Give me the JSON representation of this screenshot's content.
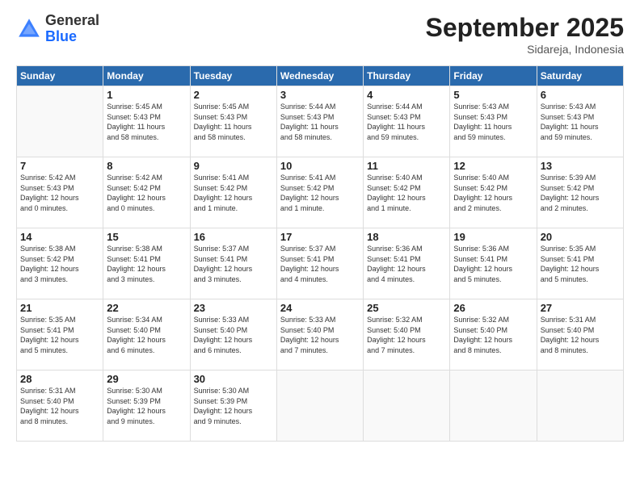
{
  "logo": {
    "general": "General",
    "blue": "Blue"
  },
  "title": "September 2025",
  "subtitle": "Sidareja, Indonesia",
  "header_days": [
    "Sunday",
    "Monday",
    "Tuesday",
    "Wednesday",
    "Thursday",
    "Friday",
    "Saturday"
  ],
  "weeks": [
    [
      {
        "day": "",
        "info": ""
      },
      {
        "day": "1",
        "info": "Sunrise: 5:45 AM\nSunset: 5:43 PM\nDaylight: 11 hours\nand 58 minutes."
      },
      {
        "day": "2",
        "info": "Sunrise: 5:45 AM\nSunset: 5:43 PM\nDaylight: 11 hours\nand 58 minutes."
      },
      {
        "day": "3",
        "info": "Sunrise: 5:44 AM\nSunset: 5:43 PM\nDaylight: 11 hours\nand 58 minutes."
      },
      {
        "day": "4",
        "info": "Sunrise: 5:44 AM\nSunset: 5:43 PM\nDaylight: 11 hours\nand 59 minutes."
      },
      {
        "day": "5",
        "info": "Sunrise: 5:43 AM\nSunset: 5:43 PM\nDaylight: 11 hours\nand 59 minutes."
      },
      {
        "day": "6",
        "info": "Sunrise: 5:43 AM\nSunset: 5:43 PM\nDaylight: 11 hours\nand 59 minutes."
      }
    ],
    [
      {
        "day": "7",
        "info": "Sunrise: 5:42 AM\nSunset: 5:43 PM\nDaylight: 12 hours\nand 0 minutes."
      },
      {
        "day": "8",
        "info": "Sunrise: 5:42 AM\nSunset: 5:42 PM\nDaylight: 12 hours\nand 0 minutes."
      },
      {
        "day": "9",
        "info": "Sunrise: 5:41 AM\nSunset: 5:42 PM\nDaylight: 12 hours\nand 1 minute."
      },
      {
        "day": "10",
        "info": "Sunrise: 5:41 AM\nSunset: 5:42 PM\nDaylight: 12 hours\nand 1 minute."
      },
      {
        "day": "11",
        "info": "Sunrise: 5:40 AM\nSunset: 5:42 PM\nDaylight: 12 hours\nand 1 minute."
      },
      {
        "day": "12",
        "info": "Sunrise: 5:40 AM\nSunset: 5:42 PM\nDaylight: 12 hours\nand 2 minutes."
      },
      {
        "day": "13",
        "info": "Sunrise: 5:39 AM\nSunset: 5:42 PM\nDaylight: 12 hours\nand 2 minutes."
      }
    ],
    [
      {
        "day": "14",
        "info": "Sunrise: 5:38 AM\nSunset: 5:42 PM\nDaylight: 12 hours\nand 3 minutes."
      },
      {
        "day": "15",
        "info": "Sunrise: 5:38 AM\nSunset: 5:41 PM\nDaylight: 12 hours\nand 3 minutes."
      },
      {
        "day": "16",
        "info": "Sunrise: 5:37 AM\nSunset: 5:41 PM\nDaylight: 12 hours\nand 3 minutes."
      },
      {
        "day": "17",
        "info": "Sunrise: 5:37 AM\nSunset: 5:41 PM\nDaylight: 12 hours\nand 4 minutes."
      },
      {
        "day": "18",
        "info": "Sunrise: 5:36 AM\nSunset: 5:41 PM\nDaylight: 12 hours\nand 4 minutes."
      },
      {
        "day": "19",
        "info": "Sunrise: 5:36 AM\nSunset: 5:41 PM\nDaylight: 12 hours\nand 5 minutes."
      },
      {
        "day": "20",
        "info": "Sunrise: 5:35 AM\nSunset: 5:41 PM\nDaylight: 12 hours\nand 5 minutes."
      }
    ],
    [
      {
        "day": "21",
        "info": "Sunrise: 5:35 AM\nSunset: 5:41 PM\nDaylight: 12 hours\nand 5 minutes."
      },
      {
        "day": "22",
        "info": "Sunrise: 5:34 AM\nSunset: 5:40 PM\nDaylight: 12 hours\nand 6 minutes."
      },
      {
        "day": "23",
        "info": "Sunrise: 5:33 AM\nSunset: 5:40 PM\nDaylight: 12 hours\nand 6 minutes."
      },
      {
        "day": "24",
        "info": "Sunrise: 5:33 AM\nSunset: 5:40 PM\nDaylight: 12 hours\nand 7 minutes."
      },
      {
        "day": "25",
        "info": "Sunrise: 5:32 AM\nSunset: 5:40 PM\nDaylight: 12 hours\nand 7 minutes."
      },
      {
        "day": "26",
        "info": "Sunrise: 5:32 AM\nSunset: 5:40 PM\nDaylight: 12 hours\nand 8 minutes."
      },
      {
        "day": "27",
        "info": "Sunrise: 5:31 AM\nSunset: 5:40 PM\nDaylight: 12 hours\nand 8 minutes."
      }
    ],
    [
      {
        "day": "28",
        "info": "Sunrise: 5:31 AM\nSunset: 5:40 PM\nDaylight: 12 hours\nand 8 minutes."
      },
      {
        "day": "29",
        "info": "Sunrise: 5:30 AM\nSunset: 5:39 PM\nDaylight: 12 hours\nand 9 minutes."
      },
      {
        "day": "30",
        "info": "Sunrise: 5:30 AM\nSunset: 5:39 PM\nDaylight: 12 hours\nand 9 minutes."
      },
      {
        "day": "",
        "info": ""
      },
      {
        "day": "",
        "info": ""
      },
      {
        "day": "",
        "info": ""
      },
      {
        "day": "",
        "info": ""
      }
    ]
  ]
}
